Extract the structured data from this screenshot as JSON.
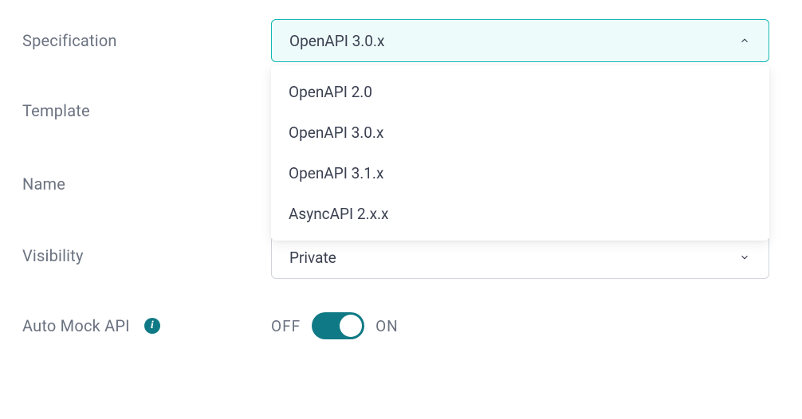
{
  "fields": {
    "specification": {
      "label": "Specification",
      "selected": "OpenAPI 3.0.x",
      "options": [
        "OpenAPI 2.0",
        "OpenAPI 3.0.x",
        "OpenAPI 3.1.x",
        "AsyncAPI 2.x.x"
      ],
      "expanded": true
    },
    "template": {
      "label": "Template"
    },
    "name": {
      "label": "Name"
    },
    "visibility": {
      "label": "Visibility",
      "selected": "Private"
    },
    "autoMock": {
      "label": "Auto Mock API",
      "offLabel": "OFF",
      "onLabel": "ON",
      "value": true
    }
  },
  "colors": {
    "accent": "#0f7a85",
    "selectOpenBorder": "#14b8b3",
    "selectOpenBg": "#eefbfb"
  }
}
